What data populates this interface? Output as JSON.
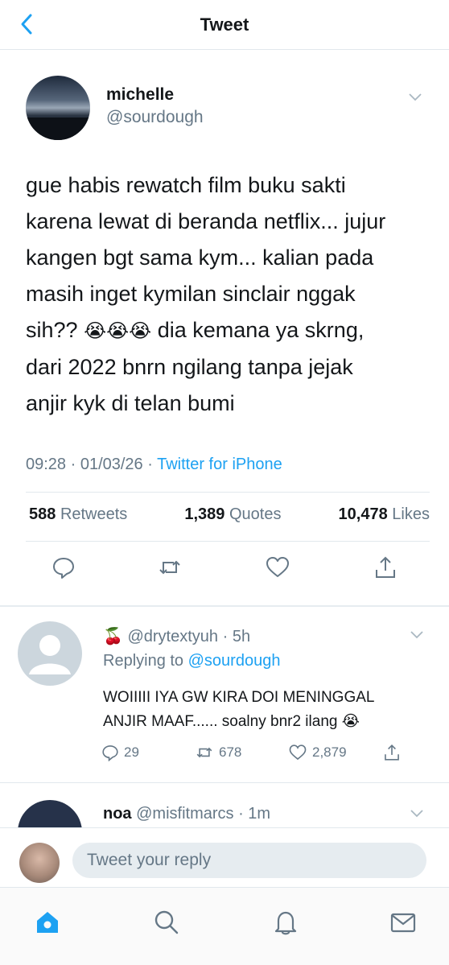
{
  "header": {
    "title": "Tweet",
    "back_icon": "chevron-left-icon"
  },
  "tweet": {
    "author_name": "michelle",
    "author_handle": "@sourdough",
    "text_line1": "gue habis rewatch film buku sakti",
    "text_line2": "karena lewat di beranda netflix... jujur",
    "text_line3": "kangen bgt sama kym... kalian pada",
    "text_line4": "masih inget kymilan sinclair nggak",
    "text_line5_a": "sih?? ",
    "text_line5_emoji": "😭😭😭",
    "text_line5_b": " dia kemana ya skrng,",
    "text_line6": "dari 2022 bnrn ngilang tanpa jejak",
    "text_line7": "anjir kyk di telan bumi",
    "time": "09:28 · 01/03/26 · ",
    "source": "Twitter for iPhone",
    "retweets_count": "588",
    "retweets_label": "Retweets",
    "quotes_count": "1,389",
    "quotes_label": "Quotes",
    "likes_count": "10,478",
    "likes_label": "Likes"
  },
  "reply": {
    "emoji": "🍒",
    "handle": "@drytextyuh",
    "time": " · 5h",
    "replying_label": "Replying to ",
    "replying_mention": "@sourdough",
    "text_line1": "WOIIIII IYA GW KIRA DOI MENINGGAL",
    "text_line2": "ANJIR MAAF...... soalny bnr2 ilang 😭",
    "replies": "29",
    "retweets": "678",
    "likes": "2,879"
  },
  "reply2": {
    "name": "noa",
    "handle_time": " @misfitmarcs · 1m"
  },
  "compose": {
    "placeholder": "Tweet your reply"
  },
  "tabbar": {
    "items": [
      "home-icon",
      "search-icon",
      "notifications-icon",
      "messages-icon"
    ]
  },
  "colors": {
    "accent": "#1da1f2",
    "muted": "#657786",
    "text": "#14171a"
  }
}
